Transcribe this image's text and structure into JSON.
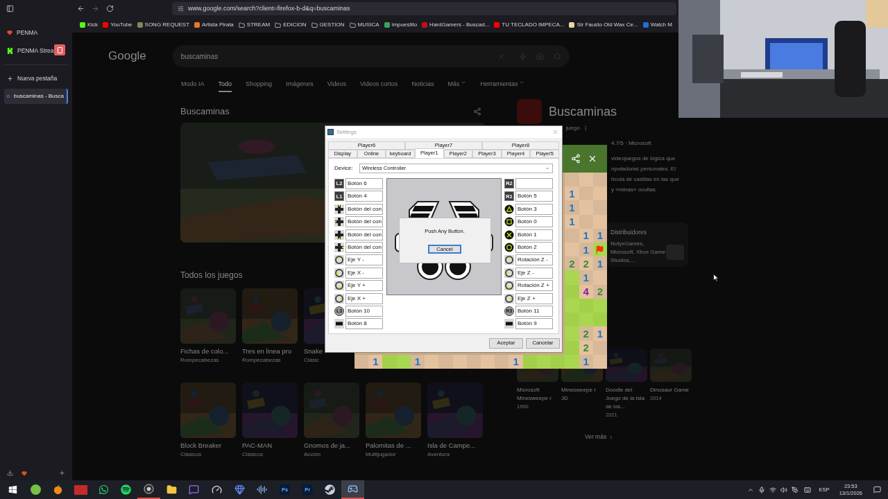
{
  "browser": {
    "url": "www.google.com/search?client=firefox-b-d&q=buscaminas",
    "bookmarks": [
      {
        "label": "Kick",
        "kind": "site",
        "color": "#53fc18"
      },
      {
        "label": "YouTube",
        "kind": "site",
        "color": "#ff0000"
      },
      {
        "label": "SONG REQUEST",
        "kind": "site",
        "color": "#7a8a5a"
      },
      {
        "label": "Artista Pirata",
        "kind": "site",
        "color": "#e07b2a"
      },
      {
        "label": "STREAM",
        "kind": "folder"
      },
      {
        "label": "EDICION",
        "kind": "folder"
      },
      {
        "label": "GESTION",
        "kind": "folder"
      },
      {
        "label": "MUSICA",
        "kind": "folder"
      },
      {
        "label": "impuestito",
        "kind": "site",
        "color": "#3aa55b"
      },
      {
        "label": "HardGamers - Buscad...",
        "kind": "site",
        "color": "#c0101a"
      },
      {
        "label": "TU TECLADO IMPECA...",
        "kind": "site",
        "color": "#ff0000"
      },
      {
        "label": "Sir Fausto Old Wax Ce...",
        "kind": "site",
        "color": "#e8d9a0"
      },
      {
        "label": "Watch M",
        "kind": "site",
        "color": "#1e6fd9"
      }
    ],
    "sidebar": {
      "pinned": [
        {
          "label": "PENMA",
          "kind": "heart"
        },
        {
          "label": "PENMA Strea",
          "kind": "kick"
        }
      ],
      "new_tab": "Nueva pestaña",
      "tabs": [
        {
          "label": "buscaminas - Busca",
          "selected": true
        }
      ]
    }
  },
  "google": {
    "logo": "Google",
    "query": "buscaminas",
    "tabs": [
      {
        "label": "Modo IA",
        "selected": false
      },
      {
        "label": "Todo",
        "selected": true
      },
      {
        "label": "Shopping",
        "selected": false
      },
      {
        "label": "Imágenes",
        "selected": false
      },
      {
        "label": "Videos",
        "selected": false
      },
      {
        "label": "Videos cortos",
        "selected": false
      },
      {
        "label": "Noticias",
        "selected": false
      },
      {
        "label": "Más",
        "selected": false,
        "menu": true
      },
      {
        "label": "Herramientas",
        "selected": false,
        "menu": true
      }
    ],
    "heading": "Buscaminas",
    "games_title": "Todos los juegos",
    "games": [
      [
        {
          "title": "Fichas de colo...",
          "genre": "Rompecabezas"
        },
        {
          "title": "Tres en linea pro",
          "genre": "Rompecabezas"
        },
        {
          "title": "Snake",
          "genre": "Clásic"
        }
      ],
      [
        {
          "title": "Block Breaker",
          "genre": "Clásicos"
        },
        {
          "title": "PAC-MAN",
          "genre": "Clásicos"
        },
        {
          "title": "Gnomos de ja...",
          "genre": "Acción"
        },
        {
          "title": "Palomitas de ...",
          "genre": "Multijugador"
        },
        {
          "title": "Isla de Campe...",
          "genre": "Aventura"
        }
      ]
    ],
    "panel": {
      "title": "Buscaminas",
      "subtitle": "juego",
      "rating": "4.7/5 · Microsoft",
      "description": [
        "videojuegos de lógica que",
        "nputadoras personales. El",
        "tícula de casillas en las que",
        "y «minas» ocultas"
      ],
      "distributors_title": "Distribuidores",
      "distributors": "NotyxGames, Microsoft, Xbox Game Studios,...",
      "related": [
        {
          "title": "Microsoft Minesweepe r",
          "year": "1990"
        },
        {
          "title": "Minesweepe r JD"
        },
        {
          "title": "Doodle del Juego de la Isla de los...",
          "year": "2021"
        },
        {
          "title": "Dinosaur Game",
          "year": "2014"
        }
      ],
      "more": "Ver más"
    }
  },
  "minesweeper": {
    "right_columns": [
      [
        {
          "kind": "open"
        },
        {
          "kind": "open"
        },
        {
          "kind": "open"
        }
      ],
      [
        {
          "kind": "open",
          "text": "1",
          "color": "#1976d2"
        },
        {
          "kind": "open"
        },
        {
          "kind": "open"
        }
      ],
      [
        {
          "kind": "open",
          "text": "1",
          "color": "#1976d2"
        },
        {
          "kind": "open"
        },
        {
          "kind": "open"
        }
      ],
      [
        {
          "kind": "open",
          "text": "1",
          "color": "#1976d2"
        },
        {
          "kind": "open"
        },
        {
          "kind": "open"
        }
      ],
      [
        {
          "kind": "open"
        },
        {
          "kind": "open",
          "text": "1",
          "color": "#1976d2"
        },
        {
          "kind": "open",
          "text": "1",
          "color": "#1976d2"
        }
      ],
      [
        {
          "kind": "open"
        },
        {
          "kind": "open",
          "text": "1",
          "color": "#1976d2"
        },
        {
          "kind": "flag"
        }
      ],
      [
        {
          "kind": "open",
          "text": "2",
          "color": "#388e3c"
        },
        {
          "kind": "open",
          "text": "2",
          "color": "#388e3c"
        },
        {
          "kind": "open",
          "text": "1",
          "color": "#1976d2"
        }
      ],
      [
        {
          "kind": "covered"
        },
        {
          "kind": "open",
          "text": "1",
          "color": "#1976d2"
        },
        {
          "kind": "open"
        }
      ],
      [
        {
          "kind": "covered"
        },
        {
          "kind": "open",
          "text": "4",
          "color": "#7b1fa2"
        },
        {
          "kind": "open",
          "text": "2",
          "color": "#388e3c"
        }
      ],
      [
        {
          "kind": "covered"
        },
        {
          "kind": "covered"
        },
        {
          "kind": "covered"
        }
      ],
      [
        {
          "kind": "covered"
        },
        {
          "kind": "covered"
        },
        {
          "kind": "covered"
        }
      ],
      [
        {
          "kind": "covered"
        },
        {
          "kind": "open",
          "text": "2",
          "color": "#388e3c"
        },
        {
          "kind": "open",
          "text": "1",
          "color": "#1976d2"
        }
      ],
      [
        {
          "kind": "covered"
        },
        {
          "kind": "open",
          "text": "2",
          "color": "#388e3c"
        },
        {
          "kind": "open"
        }
      ]
    ],
    "bottom_row": [
      {
        "kind": "open"
      },
      {
        "kind": "open",
        "text": "1",
        "color": "#1976d2"
      },
      {
        "kind": "covered"
      },
      {
        "kind": "covered"
      },
      {
        "kind": "open",
        "text": "1",
        "color": "#1976d2"
      },
      {
        "kind": "open"
      },
      {
        "kind": "open"
      },
      {
        "kind": "open"
      },
      {
        "kind": "open"
      },
      {
        "kind": "open"
      },
      {
        "kind": "open"
      },
      {
        "kind": "open",
        "text": "1",
        "color": "#1976d2"
      },
      {
        "kind": "covered"
      },
      {
        "kind": "covered"
      },
      {
        "kind": "covered"
      },
      {
        "kind": "covered"
      },
      {
        "kind": "open",
        "text": "1",
        "color": "#1976d2"
      },
      {
        "kind": "open"
      }
    ]
  },
  "dialog": {
    "title": "Settings",
    "tab_rows": [
      [
        {
          "label": "Player6",
          "selected": false
        },
        {
          "label": "Player7",
          "selected": false
        },
        {
          "label": "Player8",
          "selected": false
        }
      ],
      [
        {
          "label": "Display",
          "selected": false
        },
        {
          "label": "Online",
          "selected": false
        },
        {
          "label": "keyboard",
          "selected": false
        },
        {
          "label": "Player1",
          "selected": true
        },
        {
          "label": "Player2",
          "selected": false
        },
        {
          "label": "Player3",
          "selected": false
        },
        {
          "label": "Player4",
          "selected": false
        },
        {
          "label": "Player5",
          "selected": false
        }
      ]
    ],
    "device_label": "Device:",
    "device": "Wireless Controller",
    "left": [
      {
        "kind": "badge",
        "badge": "L2",
        "value": "Botón 6"
      },
      {
        "kind": "badge",
        "badge": "L1",
        "value": "Botón 4"
      },
      {
        "kind": "dpad",
        "value": "Botón del con"
      },
      {
        "kind": "dpad",
        "value": "Botón del con"
      },
      {
        "kind": "dpad",
        "value": "Botón del con"
      },
      {
        "kind": "dpad",
        "value": "Botón del con"
      },
      {
        "kind": "stick",
        "value": "Eje Y -"
      },
      {
        "kind": "stick",
        "value": "Eje X -"
      },
      {
        "kind": "stick",
        "value": "Eje Y +"
      },
      {
        "kind": "stick",
        "value": "Eje X +"
      },
      {
        "kind": "click",
        "badge": "L3",
        "value": "Botón 10"
      },
      {
        "kind": "menu",
        "value": "Botón 8"
      }
    ],
    "right": [
      {
        "kind": "badge",
        "badge": "R2"
      },
      {
        "kind": "badge",
        "badge": "R1",
        "value": "Botón 5"
      },
      {
        "kind": "face",
        "value": "Botón 3"
      },
      {
        "kind": "face",
        "value": "Botón 0"
      },
      {
        "kind": "face",
        "value": "Botón 1"
      },
      {
        "kind": "face",
        "value": "Botón 2"
      },
      {
        "kind": "stick",
        "value": "Rotación Z -"
      },
      {
        "kind": "stick",
        "value": "Eje Z -"
      },
      {
        "kind": "stick",
        "value": "Rotación Z +"
      },
      {
        "kind": "stick",
        "value": "Eje Z +"
      },
      {
        "kind": "click",
        "badge": "R3",
        "value": "Botón 11"
      },
      {
        "kind": "menu",
        "value": "Botón 9"
      }
    ],
    "prompt": {
      "message": "Push Any Button.",
      "button": "Cancel"
    },
    "buttons": [
      "Aceptar",
      "Cancelar"
    ]
  },
  "taskbar": {
    "apps": [
      {
        "kind": "start",
        "active": false
      },
      {
        "kind": "torrent",
        "active": false
      },
      {
        "kind": "fruit",
        "active": false
      },
      {
        "kind": "mixer",
        "active": false
      },
      {
        "kind": "whatsapp",
        "active": false
      },
      {
        "kind": "spotify",
        "active": false
      },
      {
        "kind": "obs",
        "active": true
      },
      {
        "kind": "folder",
        "active": false
      },
      {
        "kind": "chat",
        "active": false
      },
      {
        "kind": "gauge",
        "active": false
      },
      {
        "kind": "gem",
        "active": false
      },
      {
        "kind": "audio",
        "active": false
      },
      {
        "kind": "letters",
        "label": "Ps",
        "active": false
      },
      {
        "kind": "letters",
        "label": "Pr",
        "active": false
      },
      {
        "kind": "steam",
        "active": false
      },
      {
        "kind": "emulator",
        "active": true
      }
    ],
    "tray": [
      {
        "kind": "chevron"
      },
      {
        "kind": "mic"
      },
      {
        "kind": "network"
      },
      {
        "kind": "volume"
      },
      {
        "kind": "pen"
      },
      {
        "kind": "keyboard"
      }
    ],
    "language": "ESP",
    "time": "23:53",
    "date": "13/1/2026"
  }
}
